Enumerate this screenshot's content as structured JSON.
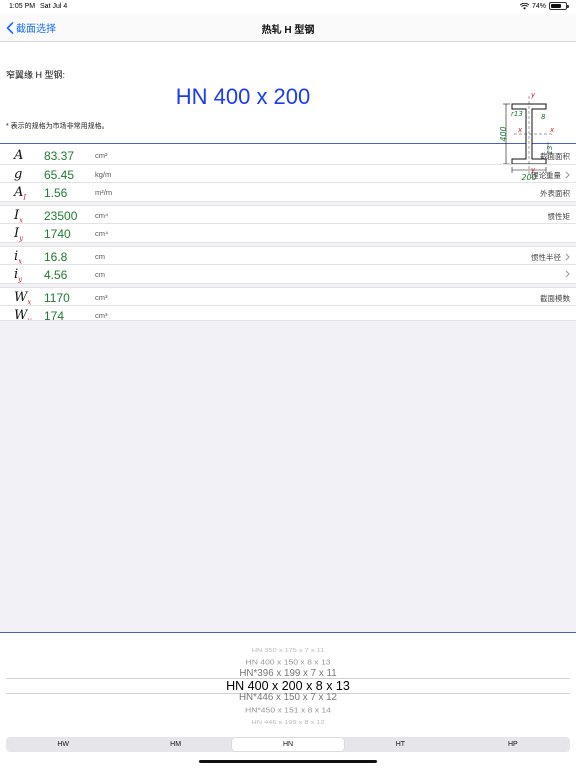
{
  "status": {
    "time": "1:05 PM",
    "date": "Sat Jul 4",
    "battery": "74%",
    "battery_level": 0.74
  },
  "nav": {
    "back_label": "截面选择",
    "title": "热轧 H 型钢"
  },
  "header": {
    "section_label": "窄翼缘 H 型钢:",
    "spec": "HN 400 x 200",
    "note": "* 表示的规格为市场非常用规格。"
  },
  "diagram": {
    "h": "400",
    "b": "200",
    "r": "r13",
    "tw": "8",
    "tf": "13",
    "x": "x",
    "y": "y"
  },
  "groups": [
    {
      "rows": [
        {
          "sym": "A",
          "sub": "",
          "value": "83.37",
          "unit": "cm²",
          "label": "截面面积",
          "chevron": false
        },
        {
          "sym": "g",
          "sub": "",
          "value": "65.45",
          "unit": "kg/m",
          "label": "理论重量",
          "chevron": true
        },
        {
          "sym": "A",
          "sub": "I",
          "value": "1.56",
          "unit": "m²/m",
          "label": "外表面积",
          "chevron": false
        }
      ]
    },
    {
      "rows": [
        {
          "sym": "I",
          "sub": "x",
          "value": "23500",
          "unit": "cm⁴",
          "label": "惯性矩",
          "chevron": false
        },
        {
          "sym": "I",
          "sub": "y",
          "value": "1740",
          "unit": "cm⁴",
          "label": "",
          "chevron": false
        }
      ]
    },
    {
      "rows": [
        {
          "sym": "i",
          "sub": "x",
          "value": "16.8",
          "unit": "cm",
          "label": "惯性半径",
          "chevron": true
        },
        {
          "sym": "i",
          "sub": "y",
          "value": "4.56",
          "unit": "cm",
          "label": "",
          "chevron": true
        }
      ]
    },
    {
      "rows": [
        {
          "sym": "W",
          "sub": "x",
          "value": "1170",
          "unit": "cm³",
          "label": "截面模数",
          "chevron": false
        },
        {
          "sym": "W",
          "sub": "y",
          "value": "174",
          "unit": "cm³",
          "label": "",
          "chevron": false
        }
      ]
    }
  ],
  "picker": {
    "items": [
      "HN 350 x 175 x 7 x 11",
      "HN 400 x 150 x 8 x 13",
      "HN*396 x 199 x 7 x 11",
      "HN 400 x 200 x 8 x 13",
      "HN*446 x 150 x 7 x 12",
      "HN*450 x 151 x 8 x 14",
      "HN 446 x 199 x 8 x 12"
    ],
    "selected_index": 3
  },
  "segments": {
    "items": [
      "HW",
      "HM",
      "HN",
      "HT",
      "HP"
    ],
    "selected": "HN"
  },
  "colors": {
    "accent": "#1a6ff5",
    "spec": "#1a3df0",
    "value": "#1f7a32",
    "subscript": "#c6252b",
    "divider": "#4a5fd6"
  }
}
